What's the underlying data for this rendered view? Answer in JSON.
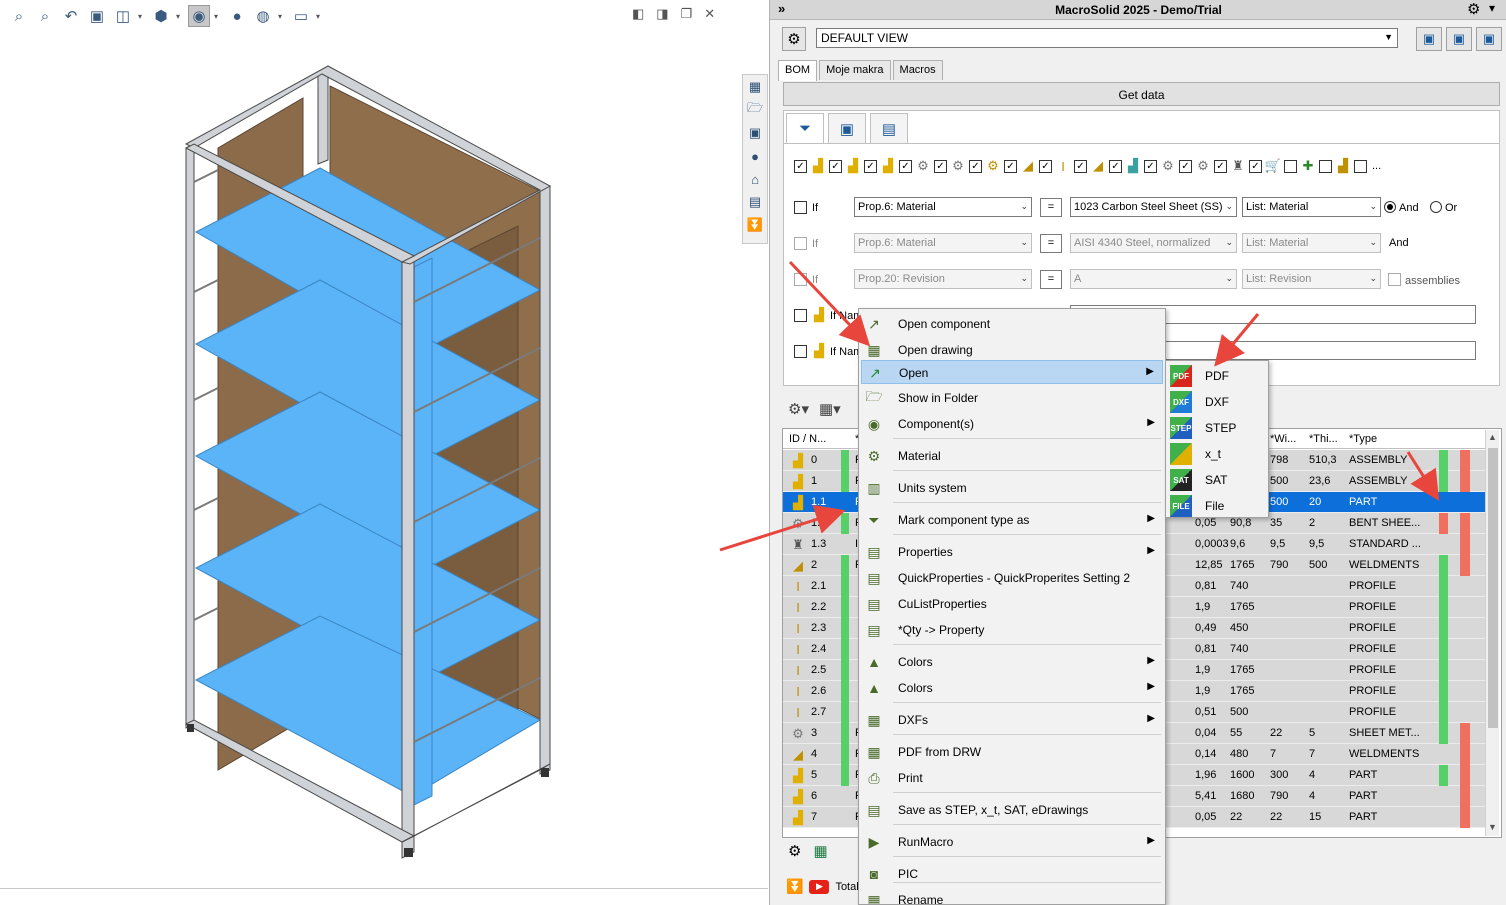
{
  "app": {
    "title": "MacroSolid 2025 - Demo/Trial",
    "expand_glyph": "»",
    "settings_glyph": "⚙",
    "pin_glyph": "▾"
  },
  "view": {
    "selected": "DEFAULT VIEW"
  },
  "tabs": [
    "BOM",
    "Moje makra",
    "Macros"
  ],
  "get_data_label": "Get data",
  "filter": {
    "rows": [
      {
        "if_label": "If",
        "prop": "Prop.6: Material",
        "op": "=",
        "value": "1023 Carbon Steel Sheet (SS)",
        "list": "List: Material",
        "and_label": "And",
        "or_label": "Or"
      },
      {
        "if_label": "If",
        "prop": "Prop.6: Material",
        "op": "=",
        "value": "AISI 4340 Steel, normalized",
        "list": "List: Material",
        "and_label": "And"
      },
      {
        "if_label": "If",
        "prop": "Prop.20: Revision",
        "op": "=",
        "value": "A",
        "list": "List: Revision",
        "assemblies_label": "assemblies"
      },
      {
        "if_label": "If Nam"
      },
      {
        "if_label": "If Nam"
      }
    ],
    "more": "..."
  },
  "table": {
    "headers": {
      "id": "ID / N...",
      "star": "*",
      "wi": "*Wi...",
      "thi": "*Thi...",
      "type": "*Type"
    },
    "rows": [
      {
        "id": "0",
        "ch": "F",
        "c1": "",
        "c2": "",
        "wi": "798",
        "thi": "510,3",
        "type": "ASSEMBLY",
        "icon": "asm",
        "green": true,
        "st1": "green",
        "st2": "red"
      },
      {
        "id": "1",
        "ch": "F",
        "c1": "",
        "c2": "",
        "wi": "500",
        "thi": "23,6",
        "type": "ASSEMBLY",
        "icon": "asm",
        "green": true,
        "st1": "green",
        "st2": "red"
      },
      {
        "id": "1.1",
        "ch": "F",
        "c1": "",
        "c2": "",
        "wi": "500",
        "thi": "20",
        "type": "PART",
        "icon": "part",
        "green": false,
        "st1": "none",
        "st2": "none",
        "selected": true
      },
      {
        "id": "1.2",
        "ch": "F",
        "c1": "0,05",
        "c2": "90,8",
        "wi": "35",
        "thi": "2",
        "type": "BENT SHEE...",
        "icon": "sheet",
        "green": true,
        "st1": "red",
        "st2": "red"
      },
      {
        "id": "1.3",
        "ch": "IS",
        "c1": "0,0003",
        "c2": "9,6",
        "wi": "9,5",
        "thi": "9,5",
        "type": "STANDARD ...",
        "icon": "std",
        "green": false,
        "st1": "none",
        "st2": "red"
      },
      {
        "id": "2",
        "ch": "F",
        "c1": "12,85",
        "c2": "1765",
        "wi": "790",
        "thi": "500",
        "type": "WELDMENTS",
        "icon": "weld",
        "green": true,
        "st1": "green",
        "st2": "red"
      },
      {
        "id": "2.1",
        "ch": "",
        "c1": "0,81",
        "c2": "740",
        "wi": "",
        "thi": "",
        "type": "PROFILE",
        "icon": "prof",
        "green": true,
        "st1": "green",
        "st2": "none"
      },
      {
        "id": "2.2",
        "ch": "",
        "c1": "1,9",
        "c2": "1765",
        "wi": "",
        "thi": "",
        "type": "PROFILE",
        "icon": "prof",
        "green": true,
        "st1": "green",
        "st2": "none"
      },
      {
        "id": "2.3",
        "ch": "",
        "c1": "0,49",
        "c2": "450",
        "wi": "",
        "thi": "",
        "type": "PROFILE",
        "icon": "prof",
        "green": true,
        "st1": "green",
        "st2": "none"
      },
      {
        "id": "2.4",
        "ch": "",
        "c1": "0,81",
        "c2": "740",
        "wi": "",
        "thi": "",
        "type": "PROFILE",
        "icon": "prof",
        "green": true,
        "st1": "green",
        "st2": "none"
      },
      {
        "id": "2.5",
        "ch": "",
        "c1": "1,9",
        "c2": "1765",
        "wi": "",
        "thi": "",
        "type": "PROFILE",
        "icon": "prof",
        "green": true,
        "st1": "green",
        "st2": "none"
      },
      {
        "id": "2.6",
        "ch": "",
        "c1": "1,9",
        "c2": "1765",
        "wi": "",
        "thi": "",
        "type": "PROFILE",
        "icon": "prof",
        "green": true,
        "st1": "green",
        "st2": "none"
      },
      {
        "id": "2.7",
        "ch": "",
        "c1": "0,51",
        "c2": "500",
        "wi": "",
        "thi": "",
        "type": "PROFILE",
        "icon": "prof",
        "green": true,
        "st1": "green",
        "st2": "none"
      },
      {
        "id": "3",
        "ch": "F",
        "c1": "0,04",
        "c2": "55",
        "wi": "22",
        "thi": "5",
        "type": "SHEET MET...",
        "icon": "sheet",
        "green": true,
        "st1": "green",
        "st2": "red"
      },
      {
        "id": "4",
        "ch": "F",
        "c1": "0,14",
        "c2": "480",
        "wi": "7",
        "thi": "7",
        "type": "WELDMENTS",
        "icon": "weld",
        "green": true,
        "st1": "none",
        "st2": "red"
      },
      {
        "id": "5",
        "ch": "F",
        "c1": "1,96",
        "c2": "1600",
        "wi": "300",
        "thi": "4",
        "type": "PART",
        "icon": "part",
        "green": true,
        "st1": "green",
        "st2": "red"
      },
      {
        "id": "6",
        "ch": "F",
        "c1": "5,41",
        "c2": "1680",
        "wi": "790",
        "thi": "4",
        "type": "PART",
        "icon": "part",
        "green": false,
        "st1": "none",
        "st2": "red"
      },
      {
        "id": "7",
        "ch": "F",
        "c1": "0,05",
        "c2": "22",
        "wi": "22",
        "thi": "15",
        "type": "PART",
        "icon": "part",
        "green": false,
        "st1": "none",
        "st2": "red"
      }
    ]
  },
  "footer": {
    "total_label": "Total"
  },
  "context_menu": {
    "items": [
      {
        "label": "Open component",
        "icon": "open-component-icon",
        "glyph": "↗",
        "submenu": false
      },
      {
        "label": "Open drawing",
        "icon": "open-drawing-icon",
        "glyph": "▦",
        "submenu": false
      },
      {
        "label": "Open",
        "icon": "open-arrow-icon",
        "glyph": "↗",
        "submenu": true,
        "highlighted": true
      },
      {
        "label": "Show in Folder",
        "icon": "folder-icon",
        "glyph": "🗁",
        "submenu": false
      },
      {
        "label": "Component(s)",
        "icon": "eye-icon",
        "glyph": "◉",
        "submenu": true
      },
      {
        "label": "Material",
        "icon": "material-icon",
        "glyph": "⚙",
        "submenu": false
      },
      {
        "label": "Units system",
        "icon": "units-icon",
        "glyph": "▥",
        "submenu": false
      },
      {
        "label": "Mark component type as",
        "icon": "filter-icon",
        "glyph": "⏷",
        "submenu": true
      },
      {
        "label": "Properties",
        "icon": "properties-icon",
        "glyph": "▤",
        "submenu": true
      },
      {
        "label": "QuickProperties - QuickProperites Setting 2",
        "icon": "quick-properties-icon",
        "glyph": "▤",
        "submenu": false
      },
      {
        "label": "CuListProperties",
        "icon": "list-properties-icon",
        "glyph": "▤",
        "submenu": false
      },
      {
        "label": "*Qty -> Property",
        "icon": "qty-icon",
        "glyph": "▤",
        "submenu": false
      },
      {
        "label": "Colors",
        "icon": "colors-icon",
        "glyph": "▲",
        "submenu": true
      },
      {
        "label": "Colors",
        "icon": "colors-icon",
        "glyph": "▲",
        "submenu": true
      },
      {
        "label": "DXFs",
        "icon": "dxf-icon",
        "glyph": "▦",
        "submenu": true
      },
      {
        "label": "PDF from DRW",
        "icon": "pdf-icon",
        "glyph": "▦",
        "submenu": false
      },
      {
        "label": "Print",
        "icon": "print-icon",
        "glyph": "⎙",
        "submenu": false
      },
      {
        "label": "Save as STEP, x_t, SAT, eDrawings",
        "icon": "save-as-icon",
        "glyph": "▤",
        "submenu": false
      },
      {
        "label": "RunMacro",
        "icon": "run-macro-icon",
        "glyph": "▶",
        "submenu": true
      },
      {
        "label": "PIC",
        "icon": "camera-icon",
        "glyph": "◙",
        "submenu": false
      },
      {
        "label": "Rename",
        "icon": "rename-icon",
        "glyph": "▦",
        "submenu": false
      }
    ],
    "arrow_glyph": "▶"
  },
  "submenu": {
    "items": [
      {
        "label": "PDF",
        "badge": "PDF",
        "color": "#d9261c"
      },
      {
        "label": "DXF",
        "badge": "DXF",
        "color": "#1f7bd6"
      },
      {
        "label": "STEP",
        "badge": "STEP",
        "color": "#1f5fbf"
      },
      {
        "label": "x_t",
        "badge": "",
        "color": "#e0b000"
      },
      {
        "label": "SAT",
        "badge": "SAT",
        "color": "#222222"
      },
      {
        "label": "File",
        "badge": "FILE",
        "color": "#1f5fbf"
      }
    ]
  },
  "colors": {
    "accent": "#0d6fd9",
    "status_green": "#58d06a",
    "status_red": "#f07060",
    "shelf_blue": "#5ab4f7",
    "panel_wood": "#8b6b4a",
    "arrow_red": "#e8453c"
  }
}
